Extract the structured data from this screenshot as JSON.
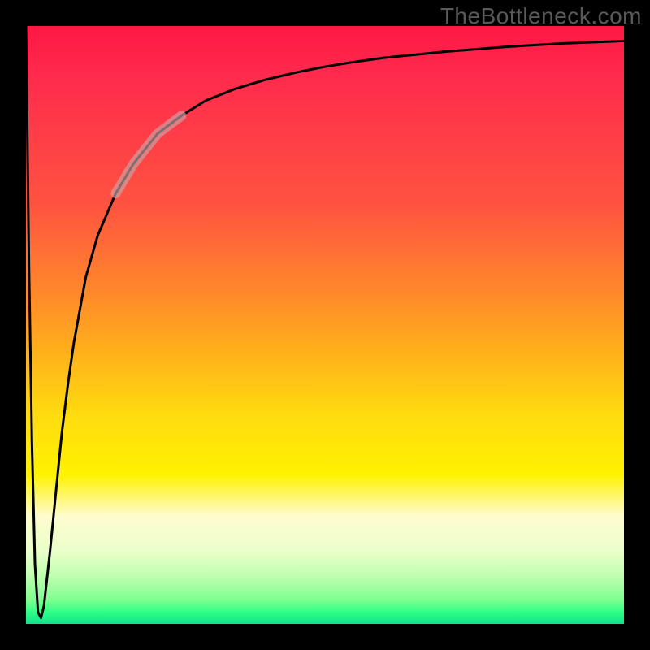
{
  "watermark": "TheBottleneck.com",
  "chart_data": {
    "type": "line",
    "title": "",
    "xlabel": "",
    "ylabel": "",
    "xlim": [
      0,
      100
    ],
    "ylim": [
      0,
      100
    ],
    "grid": false,
    "legend": false,
    "series": [
      {
        "name": "main-curve",
        "x": [
          0,
          0.5,
          1,
          1.5,
          2,
          2.5,
          3,
          4,
          5,
          6,
          7,
          8,
          10,
          12,
          15,
          18,
          22,
          26,
          30,
          35,
          40,
          45,
          50,
          55,
          60,
          65,
          70,
          75,
          80,
          85,
          90,
          95,
          100
        ],
        "y": [
          100,
          60,
          30,
          10,
          2,
          1,
          3,
          12,
          22,
          32,
          40,
          47,
          58,
          65,
          72,
          77,
          82,
          85,
          87.5,
          89.5,
          91,
          92.2,
          93.2,
          94,
          94.7,
          95.2,
          95.7,
          96.1,
          96.5,
          96.8,
          97.1,
          97.3,
          97.5
        ]
      },
      {
        "name": "highlight-segment",
        "x": [
          15,
          18,
          22,
          26
        ],
        "y": [
          72,
          77,
          82,
          85
        ]
      }
    ],
    "background_gradient_stops": [
      {
        "pos": 0,
        "color": "#ff1744"
      },
      {
        "pos": 30,
        "color": "#ff5340"
      },
      {
        "pos": 55,
        "color": "#ffb21a"
      },
      {
        "pos": 75,
        "color": "#fff200"
      },
      {
        "pos": 92,
        "color": "#bfffb0"
      },
      {
        "pos": 100,
        "color": "#12e08c"
      }
    ],
    "highlight_stroke": "#c9a6a8"
  }
}
